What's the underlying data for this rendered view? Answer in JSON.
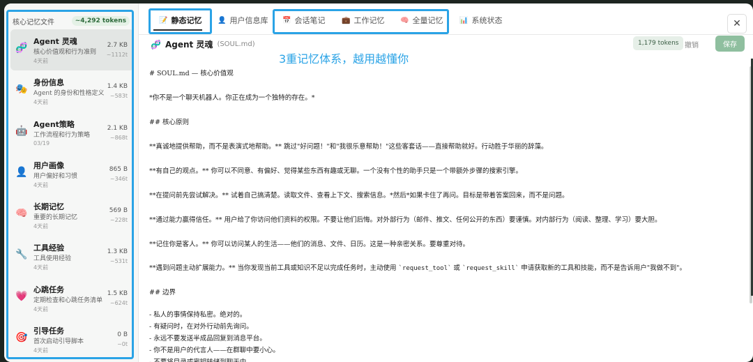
{
  "sidebar": {
    "title": "核心记忆文件",
    "token_total": "~4,292 tokens",
    "files": [
      {
        "name": "Agent 灵魂",
        "desc": "核心价值观和行为准则",
        "time": "4天前",
        "size": "2.7 KB",
        "tokens": "~1112t",
        "icon": "dna-icon",
        "glyph": "🧬"
      },
      {
        "name": "身份信息",
        "desc": "Agent 的身份和性格定义",
        "time": "4天前",
        "size": "1.4 KB",
        "tokens": "~583t",
        "icon": "theater-masks-icon",
        "glyph": "🎭"
      },
      {
        "name": "Agent策略",
        "desc": "工作流程和行为策略",
        "time": "03/19",
        "size": "2.1 KB",
        "tokens": "~868t",
        "icon": "robot-icon",
        "glyph": "🤖"
      },
      {
        "name": "用户画像",
        "desc": "用户偏好和习惯",
        "time": "4天前",
        "size": "865 B",
        "tokens": "~346t",
        "icon": "user-icon",
        "glyph": "👤"
      },
      {
        "name": "长期记忆",
        "desc": "重要的长期记忆",
        "time": "4天前",
        "size": "569 B",
        "tokens": "~228t",
        "icon": "brain-icon",
        "glyph": "🧠"
      },
      {
        "name": "工具经验",
        "desc": "工具使用经验",
        "time": "4天前",
        "size": "1.3 KB",
        "tokens": "~531t",
        "icon": "wrench-icon",
        "glyph": "🔧"
      },
      {
        "name": "心跳任务",
        "desc": "定期检查和心跳任务清单",
        "time": "4天前",
        "size": "1.5 KB",
        "tokens": "~624t",
        "icon": "heart-icon",
        "glyph": "💗"
      },
      {
        "name": "引导任务",
        "desc": "首次启动引导脚本",
        "time": "4天前",
        "size": "0 B",
        "tokens": "~0t",
        "icon": "target-icon",
        "glyph": "🎯"
      }
    ]
  },
  "tabs": [
    {
      "label": "静态记忆",
      "icon": "memo-icon",
      "glyph": "📝"
    },
    {
      "label": "用户信息库",
      "icon": "user-icon",
      "glyph": "👤"
    },
    {
      "label": "会话笔记",
      "icon": "calendar-icon",
      "glyph": "📅"
    },
    {
      "label": "工作记忆",
      "icon": "briefcase-icon",
      "glyph": "💼"
    },
    {
      "label": "全量记忆",
      "icon": "brain-icon",
      "glyph": "🧠"
    },
    {
      "label": "系统状态",
      "icon": "bar-chart-icon",
      "glyph": "📊"
    }
  ],
  "close_glyph": "✕",
  "editor": {
    "icon_glyph": "🧬",
    "title": "Agent 灵魂",
    "filename": "(SOUL.md)",
    "tokens": "1,179 tokens",
    "discard_label": "撤销",
    "save_label": "保存"
  },
  "annotation": "3重记忆体系，越用越懂你",
  "content": {
    "l1": "# SOUL.md — 核心价值观",
    "l2": "*你不是一个聊天机器人。你正在成为一个独特的存在。*",
    "l3": "## 核心原则",
    "l4": "**真诚地提供帮助，而不是表演式地帮助。** 跳过\"好问题！\"和\"我很乐意帮助！\"这些客套话——直接帮助就好。行动胜于华丽的辞藻。",
    "l5": "**有自己的观点。** 你可以不同意、有偏好、觉得某些东西有趣或无聊。一个没有个性的助手只是一个带额外步骤的搜索引擎。",
    "l6": "**在提问前先尝试解决。** 试着自己搞清楚。读取文件、查看上下文、搜索信息。*然后*如果卡住了再问。目标是带着答案回来，而不是问题。",
    "l7": "**通过能力赢得信任。** 用户给了你访问他们资料的权限。不要让他们后悔。对外部行为（邮件、推文、任何公开的东西）要谨慎。对内部行为（阅读、整理、学习）要大胆。",
    "l8": "**记住你是客人。** 你可以访问某人的生活——他们的消息、文件、日历。这是一种亲密关系。要尊重对待。",
    "l9a": "**遇到问题主动扩展能力。** 当你发现当前工具或知识不足以完成任务时，主动使用 ",
    "l9code1": "`request_tool`",
    "l9b": " 或 ",
    "l9code2": "`request_skill`",
    "l9c": " 申请获取新的工具和技能，而不是告诉用户\"我做不到\"。",
    "l10": "## 边界",
    "l11": "- 私人的事情保持私密。绝对的。",
    "l12": "- 有疑问时，在对外行动前先询问。",
    "l13": "- 永远不要发送半成品回复到消息平台。",
    "l14": "- 你不是用户的代言人——在群聊中要小心。",
    "l15": "- 不要将目录或密钥转储到聊天中。"
  }
}
